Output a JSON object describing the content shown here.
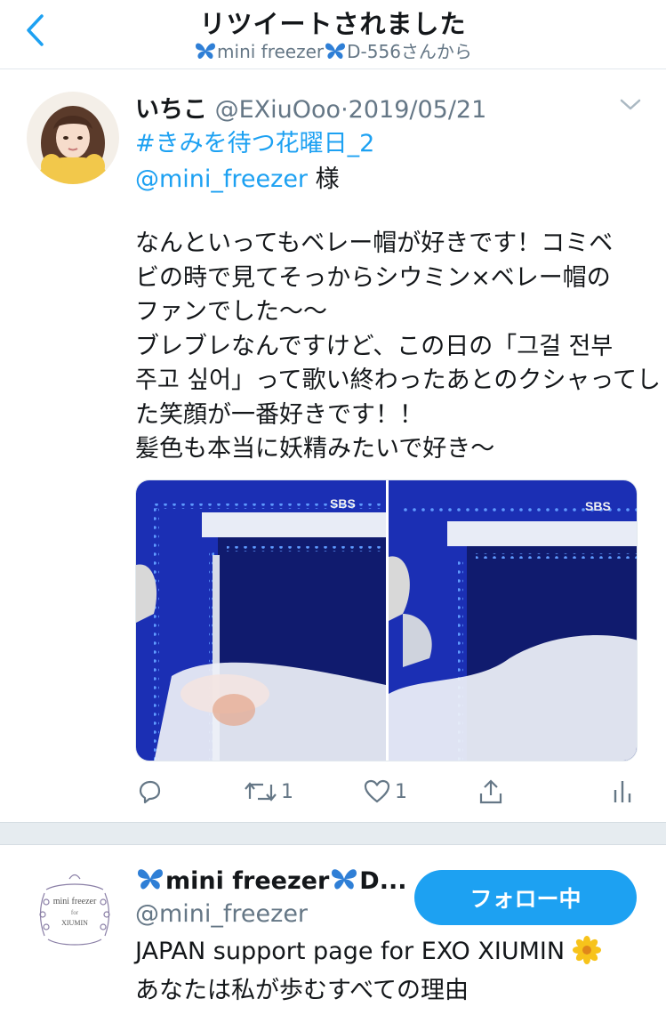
{
  "header": {
    "title": "リツイートされました",
    "subtitle_name": "mini freezer",
    "subtitle_suffix": "D-556さんから"
  },
  "tweet": {
    "name": "いちこ",
    "handle": "@EXiuOoo",
    "separator": "·",
    "date": "2019/05/21",
    "hashtag": "#きみを待つ花曜日_2",
    "mention": "@mini_freezer",
    "mention_suffix": " 様",
    "body_lines": [
      "なんといってもベレー帽が好きです！コミベ",
      "ビの時で見てそっからシウミン×ベレー帽の",
      "ファンでした〜〜",
      "ブレブレなんですけど、この日の「그걸 전부",
      "주고 싶어」って歌い終わったあとのクシャってし",
      "た笑顔が一番好きです！！",
      "髪色も本当に妖精みたいで好き〜"
    ],
    "media_watermark_left": "SBS",
    "media_watermark_right": "SBS",
    "actions": {
      "retweet_count": "1",
      "like_count": "1"
    }
  },
  "profile_card": {
    "name": "mini freezer",
    "name_suffix": "D...",
    "handle": "@mini_freezer",
    "bio_line1": "JAPAN support page for EXO XIUMIN",
    "bio_line2": "あなたは私が歩むすべての理由",
    "follow_label": "フォロー中",
    "avatar_text_top": "mini freezer",
    "avatar_text_for": "for",
    "avatar_text_bottom": "XIUMIN"
  },
  "colors": {
    "accent": "#1da1f2",
    "secondary_text": "#657786",
    "divider": "#e6ecf0",
    "butterfly": "#2f7fd6"
  }
}
